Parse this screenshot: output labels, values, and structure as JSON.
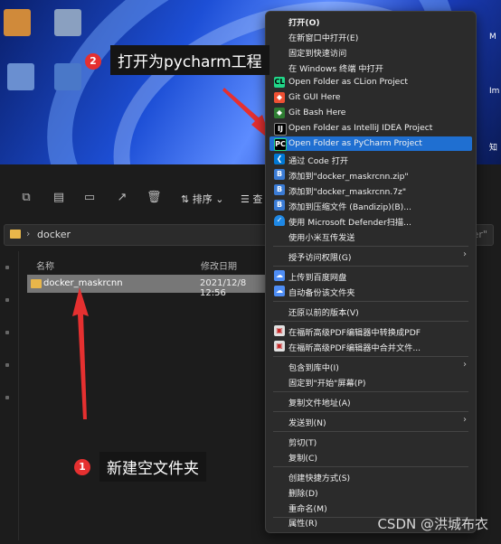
{
  "desktop": {
    "right_labels": [
      "M",
      "Im",
      "知"
    ]
  },
  "explorer": {
    "sort_label": "排序",
    "view_label": "查",
    "breadcrumb": "docker",
    "address_right": "cker\"",
    "columns": {
      "name": "名称",
      "date": "修改日期"
    },
    "rows": [
      {
        "name": "docker_maskrcnn",
        "date": "2021/12/8 12:56"
      }
    ]
  },
  "context_menu": {
    "items": [
      {
        "label": "打开(O)",
        "icon": "",
        "bold": true
      },
      {
        "label": "在新窗口中打开(E)",
        "icon": ""
      },
      {
        "label": "固定到快速访问",
        "icon": ""
      },
      {
        "label": "在 Windows 终端 中打开",
        "icon": ""
      },
      {
        "label": "Open Folder as CLion Project",
        "icon": "clion-icon"
      },
      {
        "label": "Git GUI Here",
        "icon": "git-gui-icon"
      },
      {
        "label": "Git Bash Here",
        "icon": "git-bash-icon"
      },
      {
        "label": "Open Folder as IntelliJ IDEA Project",
        "icon": "intellij-icon"
      },
      {
        "label": "Open Folder as PyCharm Project",
        "icon": "pycharm-icon",
        "highlighted": true
      },
      {
        "label": "通过 Code 打开",
        "icon": "vscode-icon"
      },
      {
        "label": "添加到\"docker_maskrcnn.zip\"",
        "icon": "bandizip-icon"
      },
      {
        "label": "添加到\"docker_maskrcnn.7z\"",
        "icon": "bandizip-icon"
      },
      {
        "label": "添加到压缩文件 (Bandizip)(B)...",
        "icon": "bandizip-icon"
      },
      {
        "label": "使用 Microsoft Defender扫描...",
        "icon": "defender-icon"
      },
      {
        "label": "使用小米互传发送",
        "icon": ""
      },
      {
        "label": "授予访问权限(G)",
        "icon": "",
        "submenu": true
      },
      {
        "label": "上传到百度网盘",
        "icon": "baidu-icon"
      },
      {
        "label": "自动备份该文件夹",
        "icon": "baidu-icon"
      },
      {
        "label": "还原以前的版本(V)",
        "icon": ""
      },
      {
        "label": "在福昕高级PDF编辑器中转换成PDF",
        "icon": "foxit-icon"
      },
      {
        "label": "在福昕高级PDF编辑器中合并文件...",
        "icon": "foxit-icon"
      },
      {
        "label": "包含到库中(I)",
        "icon": "",
        "submenu": true
      },
      {
        "label": "固定到\"开始\"屏幕(P)",
        "icon": ""
      },
      {
        "label": "复制文件地址(A)",
        "icon": ""
      },
      {
        "label": "发送到(N)",
        "icon": "",
        "submenu": true
      },
      {
        "label": "剪切(T)",
        "icon": ""
      },
      {
        "label": "复制(C)",
        "icon": ""
      },
      {
        "label": "创建快捷方式(S)",
        "icon": ""
      },
      {
        "label": "删除(D)",
        "icon": ""
      },
      {
        "label": "重命名(M)",
        "icon": ""
      },
      {
        "label": "属性(R)",
        "icon": ""
      }
    ]
  },
  "annotations": {
    "step1": {
      "number": "1",
      "text": "新建空文件夹"
    },
    "step2": {
      "number": "2",
      "text": "打开为pycharm工程"
    }
  },
  "watermark": "CSDN @洪城布衣",
  "colors": {
    "highlight": "#1f6fd1",
    "badge": "#e53030",
    "arrow": "#e53030"
  }
}
